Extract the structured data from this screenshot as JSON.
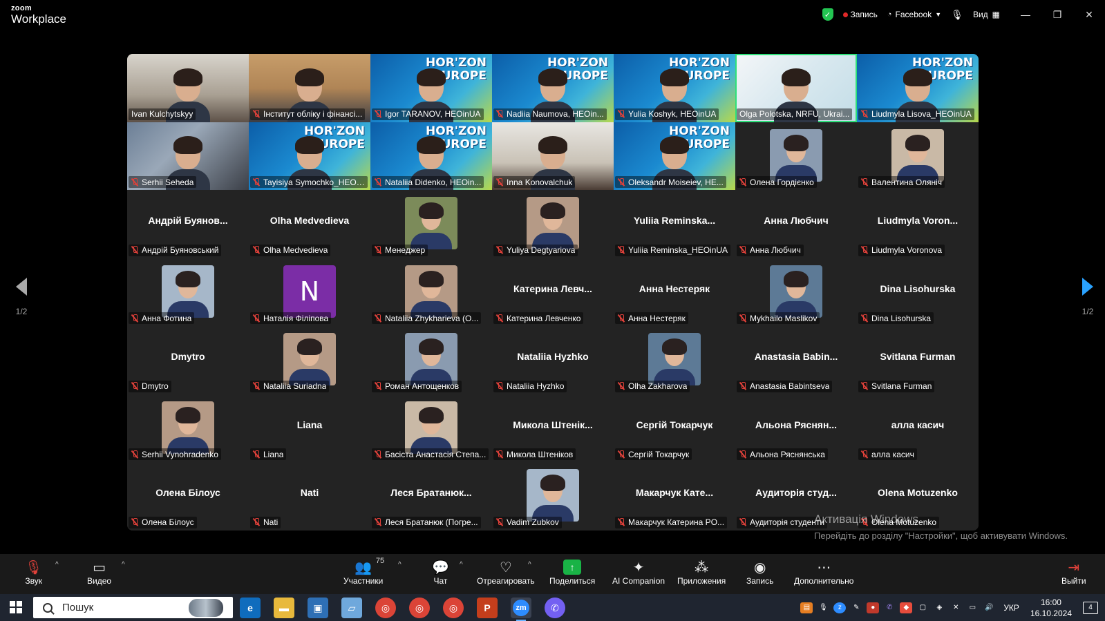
{
  "app": {
    "logo_line1": "zoom",
    "logo_line2": "Workplace"
  },
  "titlebar": {
    "record_label": "Запись",
    "live_label": "Facebook",
    "view_label": "Вид"
  },
  "gallery": {
    "page_label": "1/2",
    "tiles": [
      {
        "label": "Ivan Kulchytskyy",
        "muted": false,
        "kind": "video",
        "bg": "bg-office"
      },
      {
        "label": "Інститут обліку і фінансі...",
        "muted": true,
        "kind": "video",
        "bg": "bg-wood"
      },
      {
        "label": "Igor TARANOV, HEOinUA",
        "muted": true,
        "kind": "video",
        "bg": "bg-horizon",
        "horizon": "HOR'ZON\nEUROPE"
      },
      {
        "label": "Nadiia Naumova, HEOin...",
        "muted": true,
        "kind": "video",
        "bg": "bg-horizon",
        "horizon": "HOR'ZON\nEUROPE"
      },
      {
        "label": "Yulia Koshyk, HEOinUA",
        "muted": true,
        "kind": "video",
        "bg": "bg-horizon",
        "horizon": "HOR'ZON\nEUROPE"
      },
      {
        "label": "Olga Polotska, NRFU, Ukrai...",
        "muted": false,
        "kind": "video",
        "bg": "bg-molecule",
        "active": true
      },
      {
        "label": "Liudmyla Lisova_HEOinUA",
        "muted": true,
        "kind": "video",
        "bg": "bg-horizon",
        "horizon": "HOR'ZON\nEUROPE"
      },
      {
        "label": "Serhii Seheda",
        "muted": true,
        "kind": "video",
        "bg": "bg-map"
      },
      {
        "label": "Tayisiya Symochko_HEOi...",
        "muted": true,
        "kind": "video",
        "bg": "bg-horizon",
        "horizon": "HOR'ZON\nEUROPE"
      },
      {
        "label": "Nataliia Didenko, HEOin...",
        "muted": true,
        "kind": "video",
        "bg": "bg-horizon",
        "horizon": "HOR'ZON\nEUROPE"
      },
      {
        "label": "Inna Konovalchuk",
        "muted": true,
        "kind": "video",
        "bg": "bg-room"
      },
      {
        "label": "Oleksandr Moiseiev, HE...",
        "muted": true,
        "kind": "video",
        "bg": "bg-horizon",
        "horizon": "HOR'ZON\nEUROPE"
      },
      {
        "label": "Олена Гордієнко",
        "muted": true,
        "kind": "avatar"
      },
      {
        "label": "Валентина Оляніч",
        "muted": true,
        "kind": "avatar"
      },
      {
        "label": "Андрій Буяновський",
        "muted": true,
        "kind": "name",
        "name": "Андрій Буянов..."
      },
      {
        "label": "Olha Medvedieva",
        "muted": true,
        "kind": "name",
        "name": "Olha Medvedieva"
      },
      {
        "label": "Менеджер",
        "muted": true,
        "kind": "avatar"
      },
      {
        "label": "Yuliya Degtyariova",
        "muted": true,
        "kind": "avatar"
      },
      {
        "label": "Yuliia Reminska_HEOinUA",
        "muted": true,
        "kind": "name",
        "name": "Yuliia  Reminska..."
      },
      {
        "label": "Анна Любчич",
        "muted": true,
        "kind": "name",
        "name": "Анна Любчич"
      },
      {
        "label": "Liudmyla Voronova",
        "muted": true,
        "kind": "name",
        "name": "Liudmyla  Voron..."
      },
      {
        "label": "Анна Фотина",
        "muted": true,
        "kind": "avatar"
      },
      {
        "label": "Наталія Філіпова",
        "muted": true,
        "kind": "letter",
        "letter": "N"
      },
      {
        "label": "Nataliia Zhykharieva (O...",
        "muted": true,
        "kind": "avatar"
      },
      {
        "label": "Катерина Левченко",
        "muted": true,
        "kind": "name",
        "name": "Катерина  Левч..."
      },
      {
        "label": "Анна Нестеряк",
        "muted": true,
        "kind": "name",
        "name": "Анна Нестеряк"
      },
      {
        "label": "Mykhailo Maslikov",
        "muted": true,
        "kind": "avatar"
      },
      {
        "label": "Dina Lisohurska",
        "muted": true,
        "kind": "name",
        "name": "Dina Lisohurska"
      },
      {
        "label": "Dmytro",
        "muted": true,
        "kind": "name",
        "name": "Dmytro"
      },
      {
        "label": "Nataliia Suriadna",
        "muted": true,
        "kind": "avatar"
      },
      {
        "label": "Роман Антощенков",
        "muted": true,
        "kind": "avatar"
      },
      {
        "label": "Nataliia Hyzhko",
        "muted": true,
        "kind": "name",
        "name": "Nataliia Hyzhko"
      },
      {
        "label": "Olha Zakharova",
        "muted": true,
        "kind": "avatar"
      },
      {
        "label": "Anastasia Babintseva",
        "muted": true,
        "kind": "name",
        "name": "Anastasia  Babin..."
      },
      {
        "label": "Svitlana Furman",
        "muted": true,
        "kind": "name",
        "name": "Svitlana Furman"
      },
      {
        "label": "Serhii Vynohradenko",
        "muted": true,
        "kind": "avatar"
      },
      {
        "label": "Liana",
        "muted": true,
        "kind": "name",
        "name": "Liana"
      },
      {
        "label": "Басіста Анастасія Степа...",
        "muted": true,
        "kind": "avatar"
      },
      {
        "label": "Микола Штеніков",
        "muted": true,
        "kind": "name",
        "name": "Микола  Штенік..."
      },
      {
        "label": "Сергій Токарчук",
        "muted": true,
        "kind": "name",
        "name": "Сергій Токарчук"
      },
      {
        "label": "Альона Ряснянська",
        "muted": true,
        "kind": "name",
        "name": "Альона  Ряснян..."
      },
      {
        "label": "алла касич",
        "muted": true,
        "kind": "name",
        "name": "алла касич"
      },
      {
        "label": "Олена Білоус",
        "muted": true,
        "kind": "name",
        "name": "Олена Білоус"
      },
      {
        "label": "Nati",
        "muted": true,
        "kind": "name",
        "name": "Nati"
      },
      {
        "label": "Леся Братанюк (Погре...",
        "muted": true,
        "kind": "name",
        "name": "Леся  Братанюк..."
      },
      {
        "label": "Vadim Zubkov",
        "muted": true,
        "kind": "avatar"
      },
      {
        "label": "Макарчук Катерина PO...",
        "muted": true,
        "kind": "name",
        "name": "Макарчук  Кате..."
      },
      {
        "label": "Аудиторія студенти",
        "muted": true,
        "kind": "name",
        "name": "Аудиторія  студ..."
      },
      {
        "label": "Olena Motuzenko",
        "muted": true,
        "kind": "name",
        "name": "Olena Motuzenko"
      }
    ]
  },
  "watermark": {
    "line1": "Активація Windows",
    "line2": "Перейдіть до розділу \"Настройки\", щоб активувати Windows."
  },
  "toolbar": {
    "audio": "Звук",
    "video": "Видео",
    "participants": "Участники",
    "participants_count": "75",
    "chat": "Чат",
    "react": "Отреагировать",
    "share": "Поделиться",
    "ai": "AI Companion",
    "apps": "Приложения",
    "record": "Запись",
    "more": "Дополнительно",
    "leave": "Выйти"
  },
  "taskbar": {
    "search_placeholder": "Пошук",
    "lang": "УКР",
    "time": "16:00",
    "date": "16.10.2024",
    "notifications": "4"
  },
  "colors": {
    "accent": "#2aa2ff",
    "active_speaker": "#2ee07a",
    "muted_red": "#e0413a",
    "share_green": "#19b346"
  }
}
